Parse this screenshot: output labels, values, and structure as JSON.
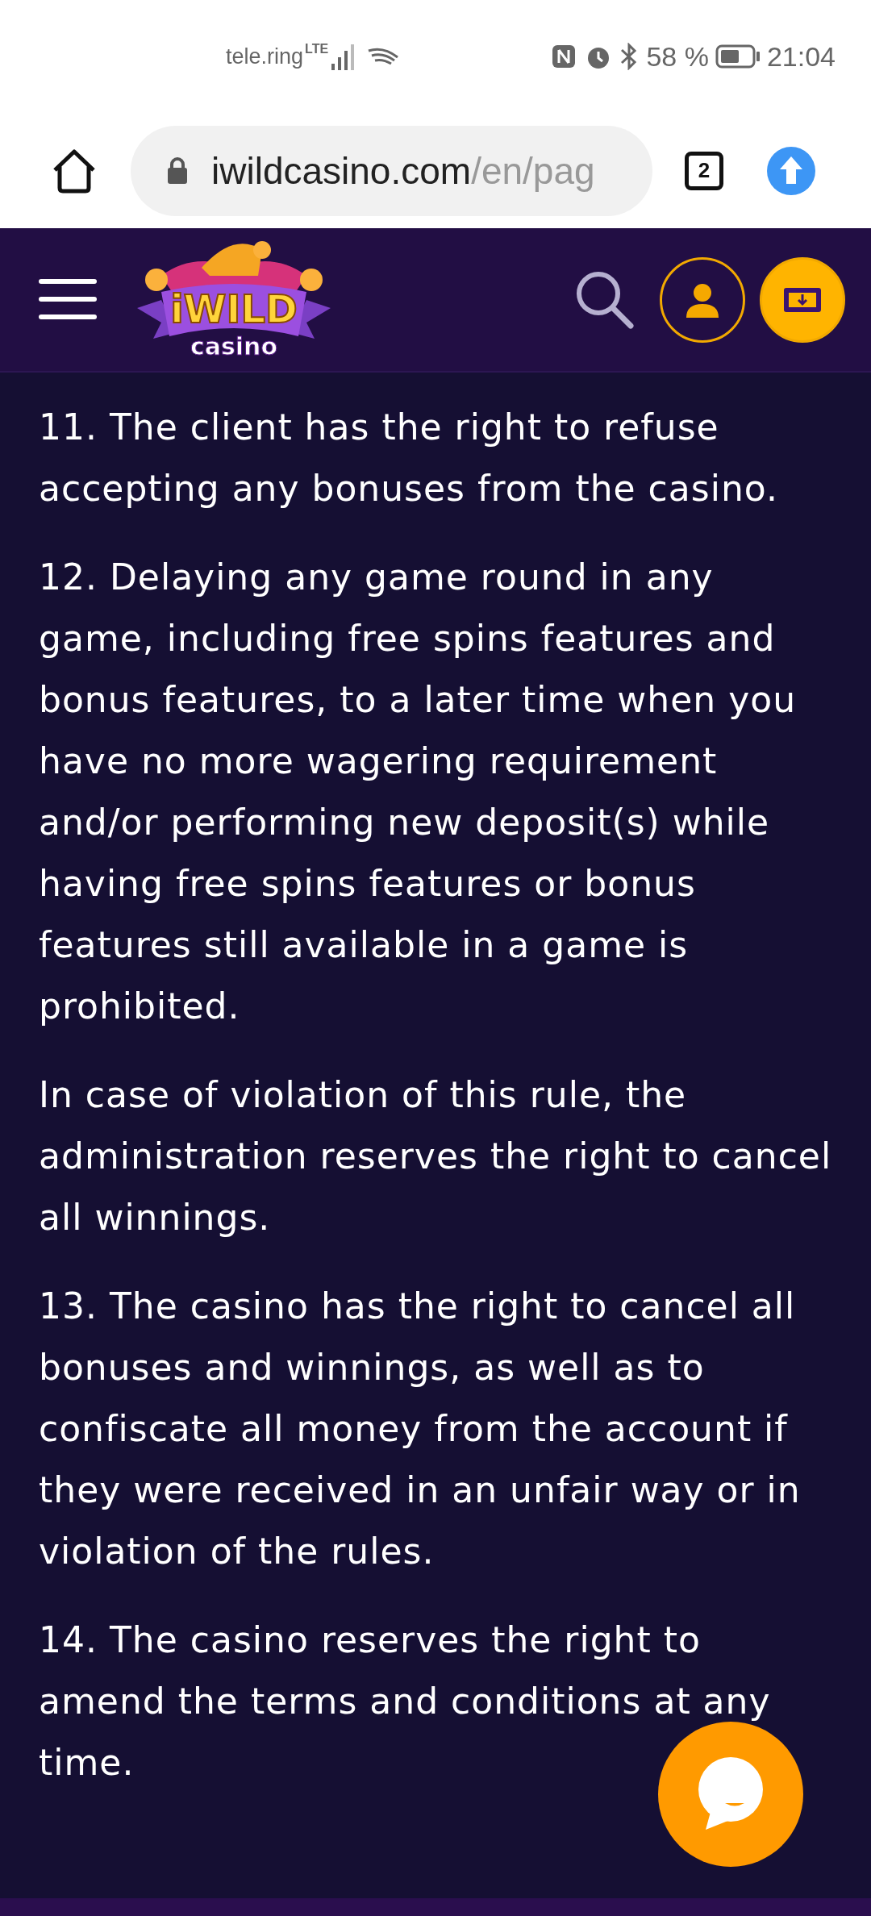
{
  "status_bar": {
    "carrier": "tele.ring",
    "network": "LTE",
    "battery": "58 %",
    "time": "21:04"
  },
  "browser": {
    "url_host": "iwildcasino.com",
    "url_path": "/en/pag",
    "tab_count": "2"
  },
  "header": {
    "logo": {
      "title": "iWILD",
      "subtitle": "casino"
    }
  },
  "paragraphs": [
    "11. The client has the right to refuse accepting any bonuses from the casino.",
    "12. Delaying any game round in any game, including free spins features and bonus features, to a later time when you have no more wagering requirement and/or performing new deposit(s) while having free spins features or bonus features still available in a game is prohibited.",
    "In case of violation of this rule, the administration reserves the right to cancel all winnings.",
    "13. The casino has the right to cancel all bonuses and winnings, as well as to confiscate all money from the account if they were received in an unfair way or in violation of the rules.",
    "14. The casino reserves the right to amend the terms and conditions at any time."
  ]
}
